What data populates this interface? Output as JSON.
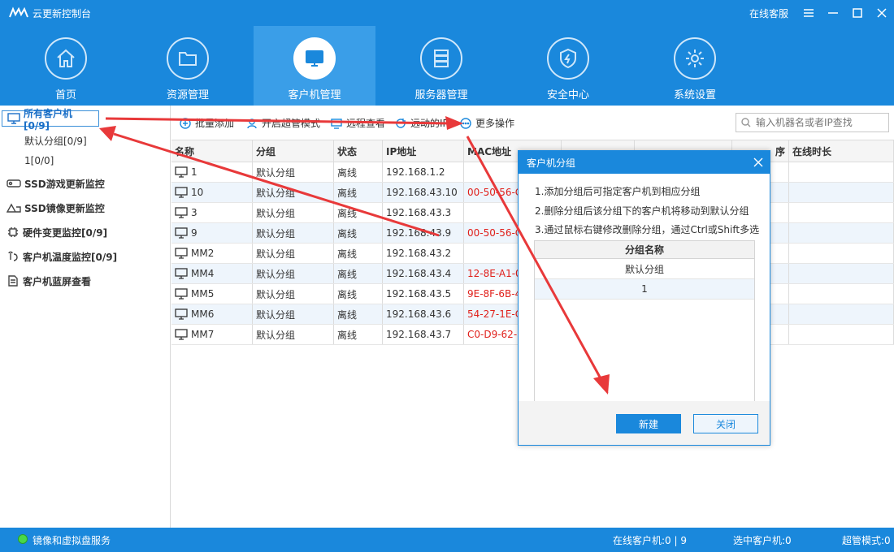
{
  "app": {
    "title": "云更新控制台",
    "online_service": "在线客服"
  },
  "nav": [
    {
      "label": "首页",
      "icon": "home-icon"
    },
    {
      "label": "资源管理",
      "icon": "folder-icon"
    },
    {
      "label": "客户机管理",
      "icon": "monitor-icon",
      "active": true
    },
    {
      "label": "服务器管理",
      "icon": "server-icon"
    },
    {
      "label": "安全中心",
      "icon": "shield-icon"
    },
    {
      "label": "系统设置",
      "icon": "gear-icon"
    }
  ],
  "sidebar": {
    "all_clients": "所有客户机[0/9]",
    "groups": [
      "默认分组[0/9]",
      "1[0/0]"
    ],
    "items": [
      {
        "label": "SSD游戏更新监控",
        "icon": "ssd-icon"
      },
      {
        "label": "SSD镜像更新监控",
        "icon": "ssd-mirror-icon"
      },
      {
        "label": "硬件变更监控[0/9]",
        "icon": "chip-icon"
      },
      {
        "label": "客户机温度监控[0/9]",
        "icon": "thermometer-icon"
      },
      {
        "label": "客户机蓝屏查看",
        "icon": "document-icon"
      }
    ]
  },
  "toolbar": {
    "batch_add": "批量添加",
    "super_mode": "开启超管模式",
    "remote_view": "远程查看",
    "wake": "远动的IP",
    "more": "更多操作",
    "search_placeholder": "输入机器名或者IP查找"
  },
  "table": {
    "headers": {
      "name": "名称",
      "group": "分组",
      "status": "状态",
      "ip": "IP地址",
      "mac": "MAC地址",
      "partial": "序",
      "online": "在线时长"
    },
    "rows": [
      {
        "name": "1",
        "group": "默认分组",
        "status": "离线",
        "ip": "192.168.1.2",
        "mac": ""
      },
      {
        "name": "10",
        "group": "默认分组",
        "status": "离线",
        "ip": "192.168.43.10",
        "mac": "00-50-56-C"
      },
      {
        "name": "3",
        "group": "默认分组",
        "status": "离线",
        "ip": "192.168.43.3",
        "mac": ""
      },
      {
        "name": "9",
        "group": "默认分组",
        "status": "离线",
        "ip": "192.168.43.9",
        "mac": "00-50-56-C"
      },
      {
        "name": "MM2",
        "group": "默认分组",
        "status": "离线",
        "ip": "192.168.43.2",
        "mac": ""
      },
      {
        "name": "MM4",
        "group": "默认分组",
        "status": "离线",
        "ip": "192.168.43.4",
        "mac": "12-8E-A1-0"
      },
      {
        "name": "MM5",
        "group": "默认分组",
        "status": "离线",
        "ip": "192.168.43.5",
        "mac": "9E-8F-6B-4"
      },
      {
        "name": "MM6",
        "group": "默认分组",
        "status": "离线",
        "ip": "192.168.43.6",
        "mac": "54-27-1E-C"
      },
      {
        "name": "MM7",
        "group": "默认分组",
        "status": "离线",
        "ip": "192.168.43.7",
        "mac": "C0-D9-62-5"
      }
    ]
  },
  "dialog": {
    "title": "客户机分组",
    "tips": [
      "1.添加分组后可指定客户机到相应分组",
      "2.删除分组后该分组下的客户机将移动到默认分组",
      "3.通过鼠标右键修改删除分组，通过Ctrl或Shift多选"
    ],
    "table_header": "分组名称",
    "groups": [
      "默认分组",
      "1"
    ],
    "new_button": "新建",
    "close_button": "关闭"
  },
  "status": {
    "service": "镜像和虚拟盘服务",
    "online_clients": "在线客户机:0 | 9",
    "selected_clients": "选中客户机:0",
    "super_mode": "超管模式:0"
  },
  "colors": {
    "primary": "#1a88dc",
    "active_nav": "#3a9ee8",
    "mac_text": "#e0201b",
    "annotation": "#e8393a"
  }
}
